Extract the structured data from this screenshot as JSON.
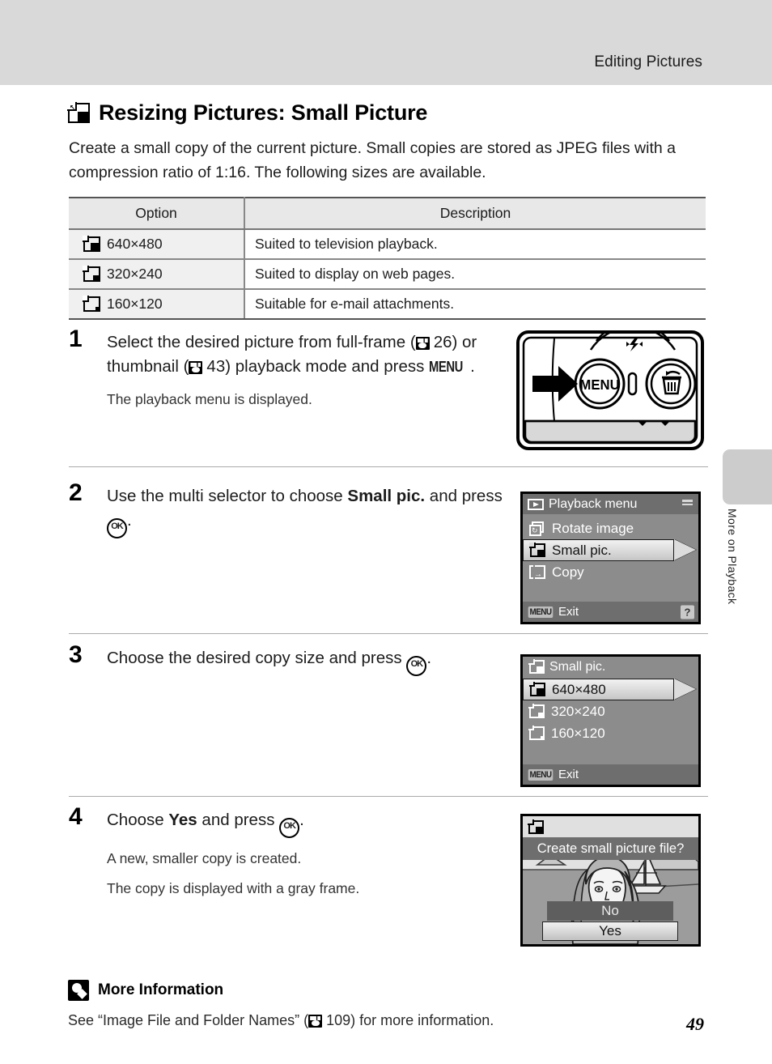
{
  "header": {
    "title": "Editing Pictures"
  },
  "side_tab": {
    "label": "More on Playback"
  },
  "section": {
    "icon": "small-picture-icon",
    "title": "Resizing Pictures: Small Picture",
    "lead": "Create a small copy of the current picture. Small copies are stored as JPEG files with a compression ratio of 1:16. The following sizes are available."
  },
  "table": {
    "headers": [
      "Option",
      "Description"
    ],
    "rows": [
      {
        "icon": "size-640-icon",
        "option": "640×480",
        "description": "Suited to television playback."
      },
      {
        "icon": "size-320-icon",
        "option": "320×240",
        "description": "Suited to display on web pages."
      },
      {
        "icon": "size-160-icon",
        "option": "160×120",
        "description": "Suitable for e-mail attachments."
      }
    ]
  },
  "steps": [
    {
      "num": "1",
      "head_a": "Select the desired picture from full-frame (",
      "ref1": "26",
      "head_b": ") or thumbnail (",
      "ref2": "43",
      "head_c": ") playback mode and press ",
      "menu_label": "MENU",
      "head_d": ".",
      "sub": [
        "The playback menu is displayed."
      ]
    },
    {
      "num": "2",
      "head_a": "Use the multi selector to choose ",
      "bold": "Small pic.",
      "head_b": " and press ",
      "ok_label": "OK",
      "head_c": ".",
      "sub": []
    },
    {
      "num": "3",
      "head_a": "Choose the desired copy size and press ",
      "ok_label": "OK",
      "head_c": ".",
      "sub": []
    },
    {
      "num": "4",
      "head_a": "Choose ",
      "bold": "Yes",
      "head_b": " and press ",
      "ok_label": "OK",
      "head_c": ".",
      "sub": [
        "A new, smaller copy is created.",
        "The copy is displayed with a gray frame."
      ]
    }
  ],
  "camera": {
    "menu_button_label": "MENU",
    "delete_button_icon": "trash-icon",
    "flash_icon": "flash-icon",
    "pointer_icon": "arrow-right-icon"
  },
  "lcd_playback_menu": {
    "title_icon": "playback-icon",
    "title": "Playback menu",
    "battery_icon": "battery-icon",
    "items": [
      {
        "icon": "rotate-image-icon",
        "label": "Rotate image",
        "selected": false
      },
      {
        "icon": "small-picture-icon",
        "label": "Small pic.",
        "selected": true
      },
      {
        "icon": "copy-icon",
        "label": "Copy",
        "selected": false
      }
    ],
    "footer": {
      "chip": "MENU",
      "label": "Exit",
      "help": "?"
    }
  },
  "lcd_small_pic": {
    "title_icon": "small-picture-icon",
    "title": "Small pic.",
    "items": [
      {
        "icon": "size-640-icon",
        "label": "640×480",
        "selected": true
      },
      {
        "icon": "size-320-icon",
        "label": "320×240",
        "selected": false
      },
      {
        "icon": "size-160-icon",
        "label": "160×120",
        "selected": false
      }
    ],
    "footer": {
      "chip": "MENU",
      "label": "Exit"
    }
  },
  "lcd_confirm": {
    "title_icon": "small-picture-icon",
    "prompt": "Create small picture file?",
    "options": [
      {
        "label": "No",
        "selected": false
      },
      {
        "label": "Yes",
        "selected": true
      }
    ]
  },
  "more_information": {
    "icon": "tip-icon",
    "heading": "More Information",
    "text_a": "See “Image File and Folder Names” (",
    "ref": "109",
    "text_b": ") for more information."
  },
  "page_number": "49",
  "colors": {
    "header_band": "#d9d9d9",
    "side_tab": "#cccccc",
    "lcd_body": "#8c8c8c",
    "lcd_bar": "#6e6e6e",
    "table_header": "#e8e8e8",
    "table_option_cell": "#f0f0f0"
  }
}
